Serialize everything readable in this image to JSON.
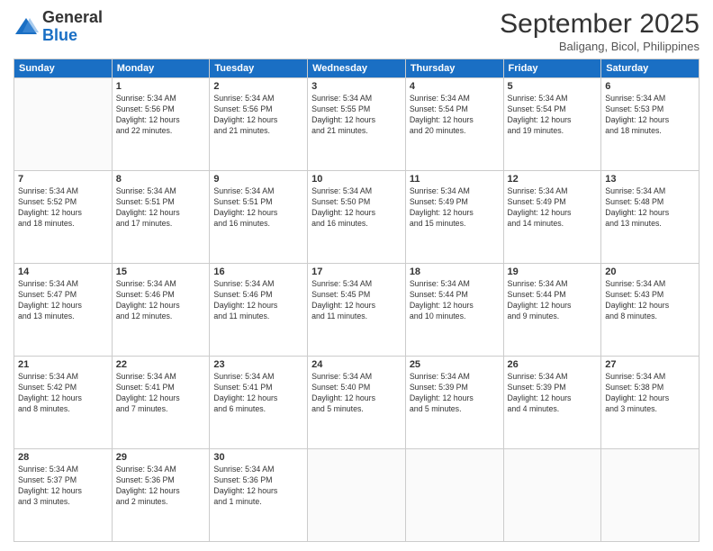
{
  "header": {
    "logo_line1": "General",
    "logo_line2": "Blue",
    "month": "September 2025",
    "location": "Baligang, Bicol, Philippines"
  },
  "days_of_week": [
    "Sunday",
    "Monday",
    "Tuesday",
    "Wednesday",
    "Thursday",
    "Friday",
    "Saturday"
  ],
  "weeks": [
    [
      {
        "day": "",
        "info": ""
      },
      {
        "day": "1",
        "info": "Sunrise: 5:34 AM\nSunset: 5:56 PM\nDaylight: 12 hours\nand 22 minutes."
      },
      {
        "day": "2",
        "info": "Sunrise: 5:34 AM\nSunset: 5:56 PM\nDaylight: 12 hours\nand 21 minutes."
      },
      {
        "day": "3",
        "info": "Sunrise: 5:34 AM\nSunset: 5:55 PM\nDaylight: 12 hours\nand 21 minutes."
      },
      {
        "day": "4",
        "info": "Sunrise: 5:34 AM\nSunset: 5:54 PM\nDaylight: 12 hours\nand 20 minutes."
      },
      {
        "day": "5",
        "info": "Sunrise: 5:34 AM\nSunset: 5:54 PM\nDaylight: 12 hours\nand 19 minutes."
      },
      {
        "day": "6",
        "info": "Sunrise: 5:34 AM\nSunset: 5:53 PM\nDaylight: 12 hours\nand 18 minutes."
      }
    ],
    [
      {
        "day": "7",
        "info": "Sunrise: 5:34 AM\nSunset: 5:52 PM\nDaylight: 12 hours\nand 18 minutes."
      },
      {
        "day": "8",
        "info": "Sunrise: 5:34 AM\nSunset: 5:51 PM\nDaylight: 12 hours\nand 17 minutes."
      },
      {
        "day": "9",
        "info": "Sunrise: 5:34 AM\nSunset: 5:51 PM\nDaylight: 12 hours\nand 16 minutes."
      },
      {
        "day": "10",
        "info": "Sunrise: 5:34 AM\nSunset: 5:50 PM\nDaylight: 12 hours\nand 16 minutes."
      },
      {
        "day": "11",
        "info": "Sunrise: 5:34 AM\nSunset: 5:49 PM\nDaylight: 12 hours\nand 15 minutes."
      },
      {
        "day": "12",
        "info": "Sunrise: 5:34 AM\nSunset: 5:49 PM\nDaylight: 12 hours\nand 14 minutes."
      },
      {
        "day": "13",
        "info": "Sunrise: 5:34 AM\nSunset: 5:48 PM\nDaylight: 12 hours\nand 13 minutes."
      }
    ],
    [
      {
        "day": "14",
        "info": "Sunrise: 5:34 AM\nSunset: 5:47 PM\nDaylight: 12 hours\nand 13 minutes."
      },
      {
        "day": "15",
        "info": "Sunrise: 5:34 AM\nSunset: 5:46 PM\nDaylight: 12 hours\nand 12 minutes."
      },
      {
        "day": "16",
        "info": "Sunrise: 5:34 AM\nSunset: 5:46 PM\nDaylight: 12 hours\nand 11 minutes."
      },
      {
        "day": "17",
        "info": "Sunrise: 5:34 AM\nSunset: 5:45 PM\nDaylight: 12 hours\nand 11 minutes."
      },
      {
        "day": "18",
        "info": "Sunrise: 5:34 AM\nSunset: 5:44 PM\nDaylight: 12 hours\nand 10 minutes."
      },
      {
        "day": "19",
        "info": "Sunrise: 5:34 AM\nSunset: 5:44 PM\nDaylight: 12 hours\nand 9 minutes."
      },
      {
        "day": "20",
        "info": "Sunrise: 5:34 AM\nSunset: 5:43 PM\nDaylight: 12 hours\nand 8 minutes."
      }
    ],
    [
      {
        "day": "21",
        "info": "Sunrise: 5:34 AM\nSunset: 5:42 PM\nDaylight: 12 hours\nand 8 minutes."
      },
      {
        "day": "22",
        "info": "Sunrise: 5:34 AM\nSunset: 5:41 PM\nDaylight: 12 hours\nand 7 minutes."
      },
      {
        "day": "23",
        "info": "Sunrise: 5:34 AM\nSunset: 5:41 PM\nDaylight: 12 hours\nand 6 minutes."
      },
      {
        "day": "24",
        "info": "Sunrise: 5:34 AM\nSunset: 5:40 PM\nDaylight: 12 hours\nand 5 minutes."
      },
      {
        "day": "25",
        "info": "Sunrise: 5:34 AM\nSunset: 5:39 PM\nDaylight: 12 hours\nand 5 minutes."
      },
      {
        "day": "26",
        "info": "Sunrise: 5:34 AM\nSunset: 5:39 PM\nDaylight: 12 hours\nand 4 minutes."
      },
      {
        "day": "27",
        "info": "Sunrise: 5:34 AM\nSunset: 5:38 PM\nDaylight: 12 hours\nand 3 minutes."
      }
    ],
    [
      {
        "day": "28",
        "info": "Sunrise: 5:34 AM\nSunset: 5:37 PM\nDaylight: 12 hours\nand 3 minutes."
      },
      {
        "day": "29",
        "info": "Sunrise: 5:34 AM\nSunset: 5:36 PM\nDaylight: 12 hours\nand 2 minutes."
      },
      {
        "day": "30",
        "info": "Sunrise: 5:34 AM\nSunset: 5:36 PM\nDaylight: 12 hours\nand 1 minute."
      },
      {
        "day": "",
        "info": ""
      },
      {
        "day": "",
        "info": ""
      },
      {
        "day": "",
        "info": ""
      },
      {
        "day": "",
        "info": ""
      }
    ]
  ]
}
